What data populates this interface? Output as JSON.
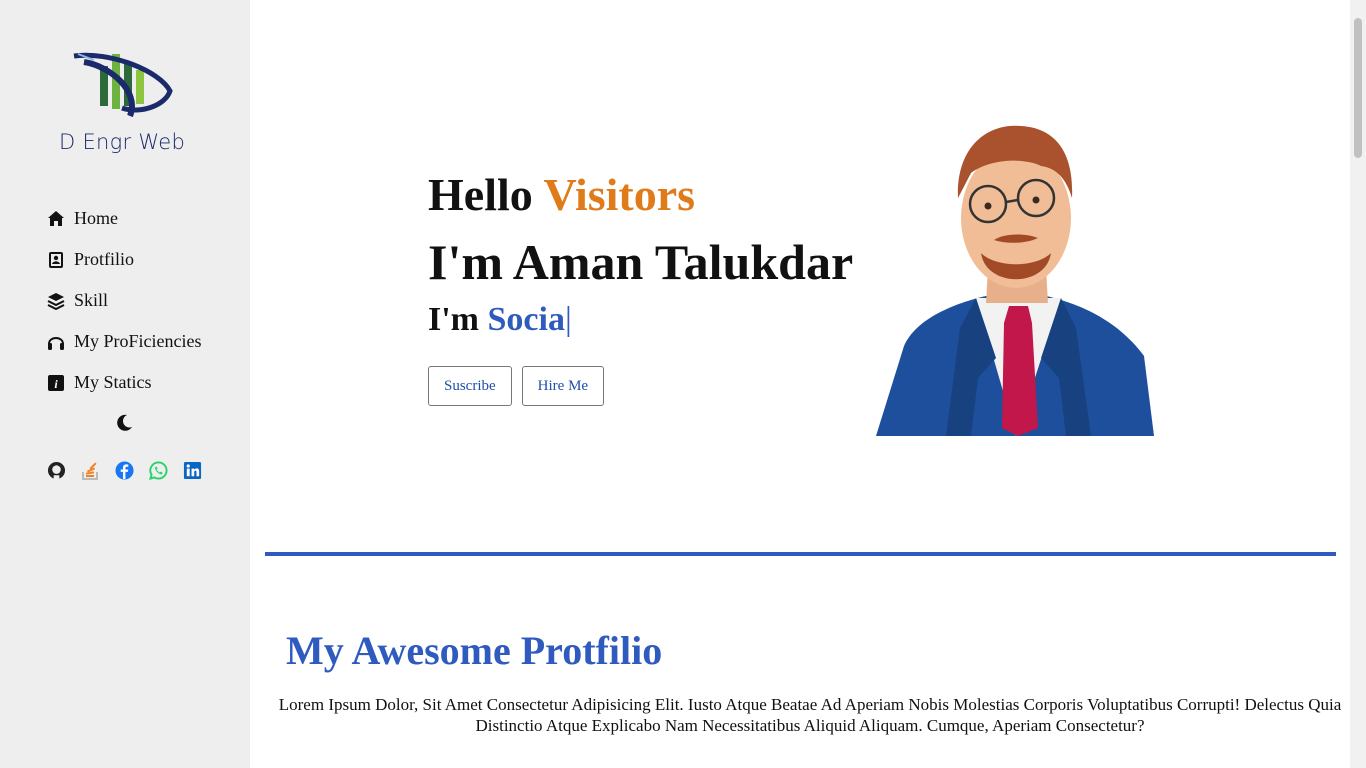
{
  "brand": {
    "name": "D Engr Web"
  },
  "sidebar": {
    "items": [
      {
        "label": "Home",
        "icon": "home-icon"
      },
      {
        "label": "Protfilio",
        "icon": "portfolio-icon"
      },
      {
        "label": "Skill",
        "icon": "layers-icon"
      },
      {
        "label": "My ProFiciencies",
        "icon": "headphones-icon"
      },
      {
        "label": "My Statics",
        "icon": "info-icon"
      }
    ],
    "theme_toggle_icon": "moon-icon",
    "socials": [
      {
        "name": "github",
        "icon": "github-icon",
        "color": "#222222"
      },
      {
        "name": "stackoverflow",
        "icon": "stackoverflow-icon",
        "color": "#f48024"
      },
      {
        "name": "facebook",
        "icon": "facebook-icon",
        "color": "#1877f2"
      },
      {
        "name": "whatsapp",
        "icon": "whatsapp-icon",
        "color": "#25d366"
      },
      {
        "name": "linkedin",
        "icon": "linkedin-icon",
        "color": "#0a66c2"
      }
    ]
  },
  "hero": {
    "hello": "Hello",
    "hello_accent": "Visitors",
    "name": "I'm Aman Talukdar",
    "role_prefix": "I'm",
    "role_typed": "Socia",
    "cursor": "|",
    "subscribe_label": "Suscribe",
    "hire_label": "Hire Me"
  },
  "portfolio": {
    "title": "My Awesome Protfilio",
    "text": "Lorem Ipsum Dolor, Sit Amet Consectetur Adipisicing Elit. Iusto Atque Beatae Ad Aperiam Nobis Molestias Corporis Voluptatibus Corrupti! Delectus Quia Distinctio Atque Explicabo Nam Necessitatibus Aliquid Aliquam. Cumque, Aperiam Consectetur?"
  },
  "colors": {
    "accent_blue": "#2f5bbf",
    "accent_orange": "#e07b1a",
    "sidebar_bg": "#eeeeee"
  }
}
